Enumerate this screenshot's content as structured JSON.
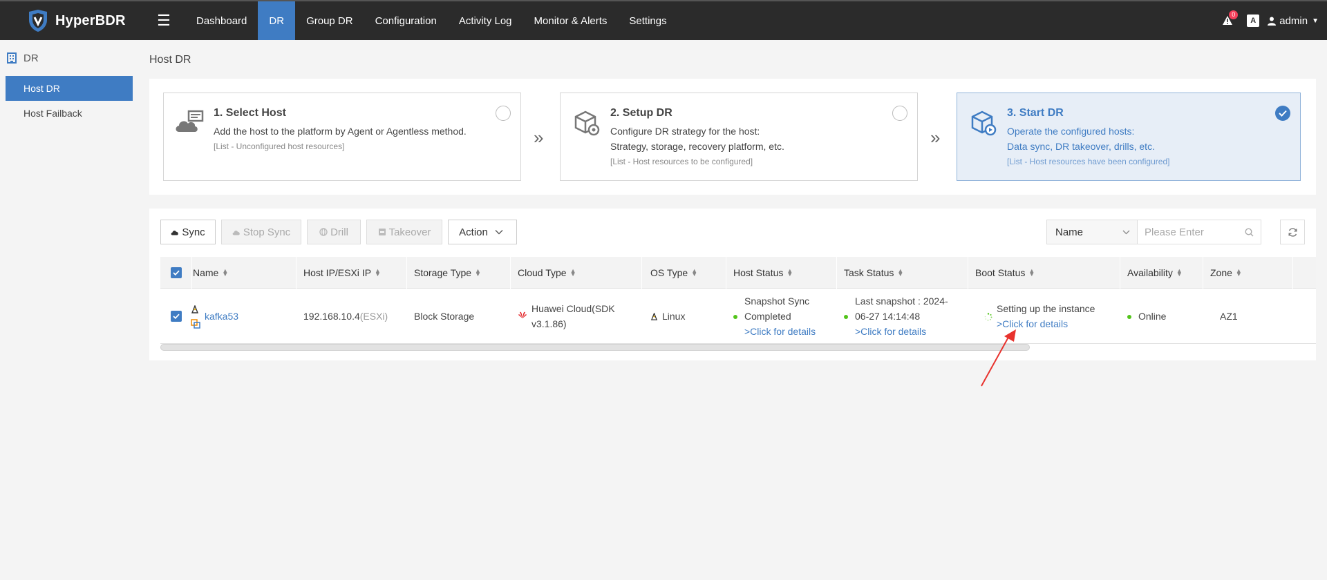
{
  "app": {
    "name": "HyperBDR"
  },
  "nav": {
    "items": [
      "Dashboard",
      "DR",
      "Group DR",
      "Configuration",
      "Activity Log",
      "Monitor & Alerts",
      "Settings"
    ],
    "active": "DR"
  },
  "topright": {
    "alert_count": "0",
    "lang_icon": "A",
    "user": "admin"
  },
  "sidebar": {
    "header": "DR",
    "items": [
      {
        "label": "Host DR",
        "active": true
      },
      {
        "label": "Host Failback",
        "active": false
      }
    ]
  },
  "page": {
    "title": "Host DR"
  },
  "steps": [
    {
      "title": "1. Select Host",
      "desc_lines": [
        "Add the host to the platform by Agent or Agentless method."
      ],
      "note": "[List - Unconfigured host resources]",
      "done": false
    },
    {
      "title": "2. Setup DR",
      "desc_lines": [
        "Configure DR strategy for the host:",
        "Strategy, storage, recovery platform, etc."
      ],
      "note": "[List - Host resources to be configured]",
      "done": false
    },
    {
      "title": "3. Start DR",
      "desc_lines": [
        "Operate the configured hosts:",
        "Data sync, DR takeover, drills, etc."
      ],
      "note": "[List - Host resources have been configured]",
      "done": true
    }
  ],
  "toolbar": {
    "sync": "Sync",
    "stop_sync": "Stop Sync",
    "drill": "Drill",
    "takeover": "Takeover",
    "action": "Action",
    "filter_field": "Name",
    "search_placeholder": "Please Enter"
  },
  "table": {
    "columns": [
      "Name",
      "Host IP/ESXi IP",
      "Storage Type",
      "Cloud Type",
      "OS Type",
      "Host Status",
      "Task Status",
      "Boot Status",
      "Availability",
      "Zone"
    ],
    "rows": [
      {
        "name": "kafka53",
        "ip": "192.168.10.4",
        "ip_suffix": "(ESXi)",
        "storage": "Block Storage",
        "cloud_line1": "Huawei Cloud(SDK",
        "cloud_line2": "v3.1.86)",
        "os": "Linux",
        "host_status_line1": "Snapshot Sync",
        "host_status_line2": "Completed",
        "host_status_link": ">Click for details",
        "task_status_line1": "Last snapshot : 2024-",
        "task_status_line2": "06-27 14:14:48",
        "task_status_link": ">Click for details",
        "boot_status": "Setting up the instance",
        "boot_status_link": ">Click for details",
        "availability": "Online",
        "zone": "AZ1"
      }
    ]
  },
  "colors": {
    "primary": "#3f7cc3",
    "topbar": "#2b2b2b",
    "online": "#52c41a",
    "annotation": "#e8322d"
  }
}
